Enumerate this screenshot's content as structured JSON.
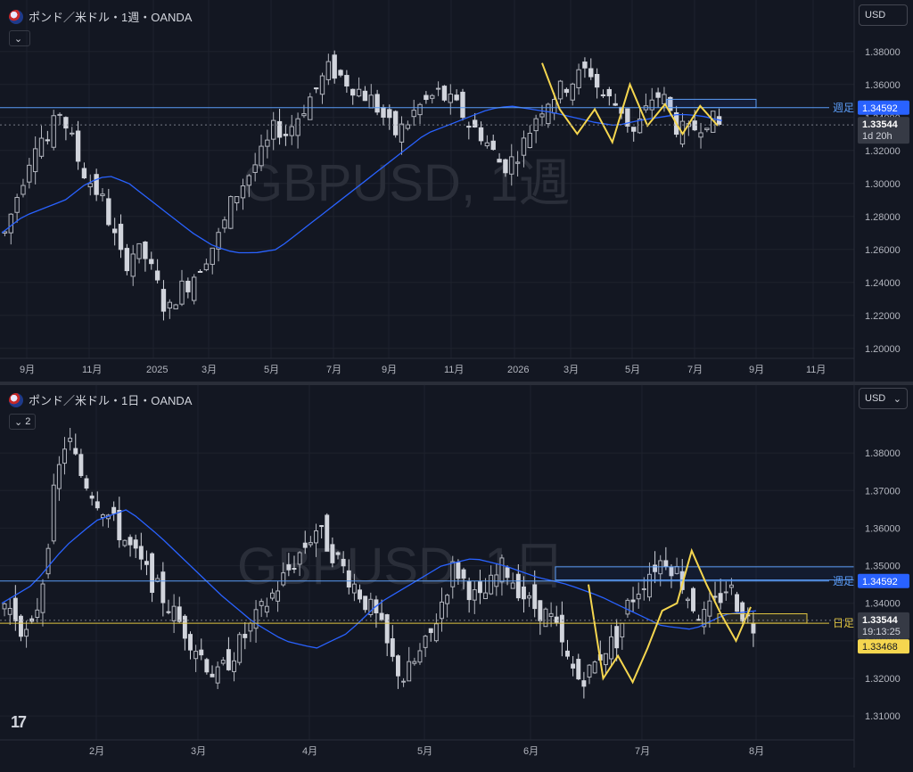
{
  "colors": {
    "bg": "#131722",
    "grid": "#1e222d",
    "up": "#b2b5be",
    "down": "#d1d4dc",
    "ma": "#2962ff",
    "zigzag": "#f5d64f",
    "level": "#5b9cf6",
    "daily_level": "#e0c441"
  },
  "weekly": {
    "title": "ポンド／米ドル・1週・OANDA",
    "watermark": "GBPUSD, 1週",
    "currency": "USD",
    "collapse_label": "",
    "price_label": "1.33544",
    "countdown": "1d 20h",
    "level_label": "1.34592",
    "level_tag": "週足"
  },
  "daily": {
    "title": "ポンド／米ドル・1日・OANDA",
    "watermark": "GBPUSD, 1日",
    "currency": "USD",
    "collapse_label": "2",
    "price_label": "1.33544",
    "countdown": "19:13:25",
    "level_label": "1.34592",
    "level_tag": "週足",
    "daily_level_label": "1.33468",
    "daily_level_tag": "日足"
  },
  "chart_data": [
    {
      "type": "candlestick",
      "symbol": "GBPUSD",
      "timeframe": "1週",
      "ylim": [
        1.195,
        1.395
      ],
      "y_ticks": [
        "1.38000",
        "1.36000",
        "1.34000",
        "1.32000",
        "1.30000",
        "1.28000",
        "1.26000",
        "1.24000",
        "1.22000",
        "1.20000"
      ],
      "x_ticks": [
        "9月",
        "11月",
        "2025",
        "3月",
        "5月",
        "7月",
        "9月",
        "11月",
        "2026",
        "3月",
        "5月",
        "7月",
        "9月",
        "11月"
      ],
      "close_path": [
        1.27,
        1.29,
        1.31,
        1.33,
        1.325,
        1.345,
        1.33,
        1.31,
        1.3,
        1.29,
        1.27,
        1.25,
        1.26,
        1.255,
        1.24,
        1.22,
        1.235,
        1.24,
        1.25,
        1.26,
        1.27,
        1.29,
        1.3,
        1.31,
        1.32,
        1.335,
        1.33,
        1.34,
        1.35,
        1.36,
        1.37,
        1.365,
        1.36,
        1.355,
        1.35,
        1.34,
        1.33,
        1.335,
        1.345,
        1.35,
        1.355,
        1.35,
        1.345,
        1.335,
        1.33,
        1.32,
        1.31,
        1.315,
        1.325,
        1.34,
        1.35,
        1.355,
        1.36,
        1.365,
        1.37,
        1.355,
        1.35,
        1.345,
        1.33,
        1.34,
        1.355,
        1.35,
        1.335,
        1.33,
        1.335,
        1.34,
        1.335
      ],
      "moving_average": [
        1.27,
        1.28,
        1.285,
        1.29,
        1.3,
        1.305,
        1.3,
        1.29,
        1.28,
        1.27,
        1.262,
        1.258,
        1.258,
        1.26,
        1.27,
        1.28,
        1.29,
        1.3,
        1.31,
        1.32,
        1.33,
        1.335,
        1.34,
        1.345,
        1.347,
        1.345,
        1.343,
        1.34,
        1.337,
        1.335,
        1.338,
        1.34,
        1.342,
        1.341,
        1.338
      ],
      "levels": [
        {
          "label": "週足",
          "value": 1.34592
        }
      ],
      "last_price": 1.33544,
      "zigzag": [
        1.373,
        1.345,
        1.33,
        1.345,
        1.325,
        1.36,
        1.335,
        1.348,
        1.33,
        1.347,
        1.335
      ]
    },
    {
      "type": "candlestick",
      "symbol": "GBPUSD",
      "timeframe": "1日",
      "ylim": [
        1.306,
        1.39
      ],
      "y_ticks": [
        "1.38000",
        "1.37000",
        "1.36000",
        "1.35000",
        "1.34000",
        "1.33000",
        "1.32000",
        "1.31000"
      ],
      "x_ticks": [
        "2月",
        "3月",
        "4月",
        "5月",
        "6月",
        "7月",
        "8月"
      ],
      "close_path": [
        1.34,
        1.336,
        1.33,
        1.345,
        1.37,
        1.385,
        1.375,
        1.37,
        1.365,
        1.36,
        1.355,
        1.35,
        1.345,
        1.34,
        1.335,
        1.33,
        1.325,
        1.32,
        1.325,
        1.33,
        1.335,
        1.34,
        1.345,
        1.35,
        1.355,
        1.36,
        1.355,
        1.35,
        1.345,
        1.34,
        1.335,
        1.325,
        1.32,
        1.325,
        1.33,
        1.34,
        1.35,
        1.345,
        1.34,
        1.345,
        1.35,
        1.345,
        1.34,
        1.338,
        1.335,
        1.325,
        1.32,
        1.322,
        1.328,
        1.33,
        1.34,
        1.345,
        1.35,
        1.352,
        1.348,
        1.34,
        1.336,
        1.34,
        1.345,
        1.338,
        1.334
      ],
      "moving_average": [
        1.34,
        1.345,
        1.355,
        1.362,
        1.365,
        1.358,
        1.35,
        1.342,
        1.335,
        1.33,
        1.328,
        1.332,
        1.34,
        1.345,
        1.35,
        1.352,
        1.35,
        1.347,
        1.345,
        1.342,
        1.338,
        1.334,
        1.333,
        1.337,
        1.338
      ],
      "levels": [
        {
          "label": "週足",
          "value": 1.34592
        },
        {
          "label": "日足",
          "value": 1.33468
        }
      ],
      "last_price": 1.33544,
      "zigzag": [
        1.345,
        1.32,
        1.326,
        1.319,
        1.328,
        1.338,
        1.34,
        1.354,
        1.345,
        1.337,
        1.33,
        1.339
      ]
    }
  ]
}
